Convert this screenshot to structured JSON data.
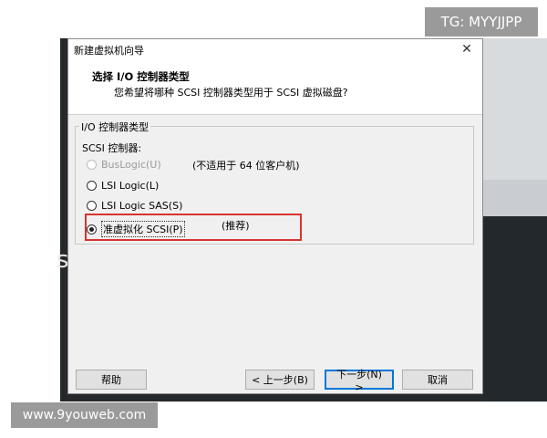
{
  "watermarks": {
    "top_right": "TG: MYYJJPP",
    "bottom_left": "www.9youweb.com"
  },
  "background": {
    "left_glyph": "s"
  },
  "dialog": {
    "title": "新建虚拟机向导",
    "close_symbol": "✕",
    "header_title": "选择 I/O 控制器类型",
    "header_subtitle": "您希望将哪种 SCSI 控制器类型用于 SCSI 虚拟磁盘?",
    "group_legend": "I/O 控制器类型",
    "scsi_label": "SCSI 控制器:",
    "options": [
      {
        "label": "BusLogic(U)",
        "note": "(不适用于 64 位客户机)",
        "enabled": false,
        "checked": false
      },
      {
        "label": "LSI Logic(L)",
        "note": "",
        "enabled": true,
        "checked": false
      },
      {
        "label": "LSI Logic SAS(S)",
        "note": "",
        "enabled": true,
        "checked": false
      },
      {
        "label": "准虚拟化 SCSI(P)",
        "note": "(推荐)",
        "enabled": true,
        "checked": true
      }
    ],
    "buttons": {
      "help": "帮助",
      "back": "< 上一步(B)",
      "next": "下一步(N) >",
      "cancel": "取消"
    },
    "highlight_color": "#d9332e"
  }
}
